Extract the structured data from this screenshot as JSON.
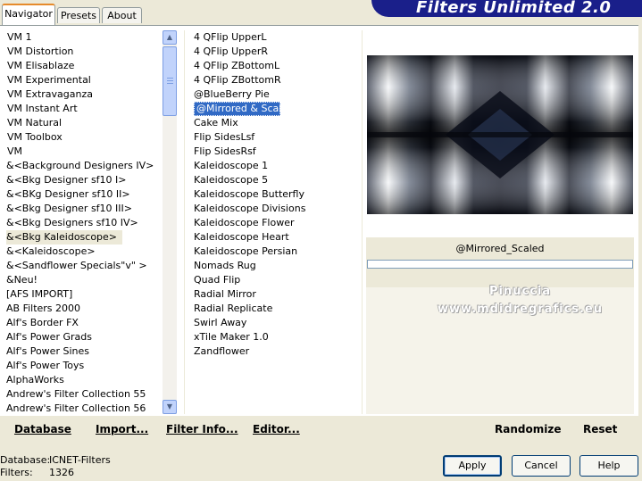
{
  "app": {
    "title": "Filters Unlimited 2.0"
  },
  "tabs": [
    {
      "label": "Navigator",
      "active": true
    },
    {
      "label": "Presets",
      "active": false
    },
    {
      "label": "About",
      "active": false
    }
  ],
  "categories": [
    "VM 1",
    "VM Distortion",
    "VM Elisablaze",
    "VM Experimental",
    "VM Extravaganza",
    "VM Instant Art",
    "VM Natural",
    "VM Toolbox",
    "VM",
    "&<Background Designers IV>",
    "&<Bkg Designer sf10 I>",
    "&<BKg Designer sf10 II>",
    "&<Bkg Designer sf10 III>",
    "&<Bkg Designers sf10 IV>",
    "&<Bkg Kaleidoscope>",
    "&<Kaleidoscope>",
    "&<Sandflower Specials\"v\" >",
    "&Neu!",
    "[AFS IMPORT]",
    "AB Filters 2000",
    "Alf's Border FX",
    "Alf's Power Grads",
    "Alf's Power Sines",
    "Alf's Power Toys",
    "AlphaWorks",
    "Andrew's Filter Collection 55",
    "Andrew's Filter Collection 56"
  ],
  "selected_category": "&<Bkg Kaleidoscope>",
  "filters": [
    "4 QFlip UpperL",
    "4 QFlip UpperR",
    "4 QFlip ZBottomL",
    "4 QFlip ZBottomR",
    "@BlueBerry Pie",
    "@Mirrored & Scaled",
    "Cake Mix",
    "Flip SidesLsf",
    "Flip SidesRsf",
    "Kaleidoscope 1",
    "Kaleidoscope 5",
    "Kaleidoscope Butterfly",
    "Kaleidoscope Divisions",
    "Kaleidoscope Flower",
    "Kaleidoscope Heart",
    "Kaleidoscope Persian",
    "Nomads Rug",
    "Quad Flip",
    "Radial Mirror",
    "Radial Replicate",
    "Swirl Away",
    "xTile Maker 1.0",
    "Zandflower"
  ],
  "selected_filter": "@Mirrored & Scaled",
  "preview": {
    "filter_label": "@Mirrored_Scaled",
    "watermark_line1": "Pinuccia",
    "watermark_line2": "www.mdidregrafics.eu"
  },
  "actions": {
    "database": "Database",
    "import": "Import...",
    "filter_info": "Filter Info...",
    "editor": "Editor...",
    "randomize": "Randomize",
    "reset": "Reset"
  },
  "status": {
    "database_label": "Database:",
    "database_value": "ICNET-Filters",
    "filters_label": "Filters:",
    "filters_value": "1326"
  },
  "buttons": {
    "apply": "Apply",
    "cancel": "Cancel",
    "help": "Help"
  },
  "colors": {
    "banner": "#1a1f8a",
    "selection": "#316ac5",
    "tab_accent": "#e68b2c"
  }
}
